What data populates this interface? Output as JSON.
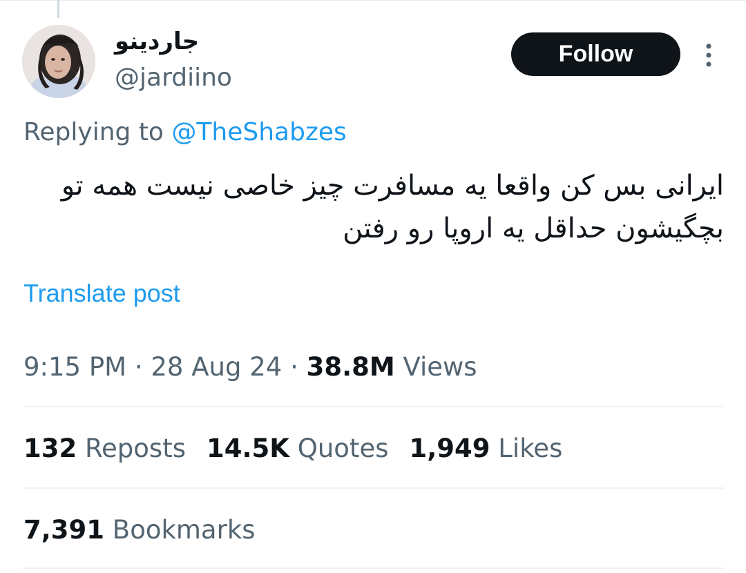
{
  "author": {
    "display_name": "جاردینو",
    "handle": "@jardiino"
  },
  "follow_label": "Follow",
  "reply": {
    "prefix": "Replying to ",
    "mention": "@TheShabzes"
  },
  "tweet": {
    "line1": "ایرانی بس کن واقعا یه مسافرت چیز خاصی نیست همه تو",
    "line2": "بچگیشون حداقل یه اروپا رو رفتن"
  },
  "translate_label": "Translate post",
  "meta": {
    "time": "9:15 PM",
    "sep1": " · ",
    "date": "28 Aug 24",
    "sep2": " · ",
    "views_count": "38.8M",
    "views_label": " Views"
  },
  "stats": {
    "reposts_count": "132",
    "reposts_label": " Reposts",
    "quotes_count": "14.5K",
    "quotes_label": " Quotes",
    "likes_count": "1,949",
    "likes_label": " Likes",
    "bookmarks_count": "7,391",
    "bookmarks_label": " Bookmarks"
  },
  "icons": {
    "more": "more-vertical-icon"
  },
  "colors": {
    "accent": "#1d9bf0",
    "text_primary": "#0f1419",
    "text_secondary": "#536471",
    "divider": "#eff3f4",
    "button_bg": "#0f1419",
    "button_text": "#ffffff"
  }
}
